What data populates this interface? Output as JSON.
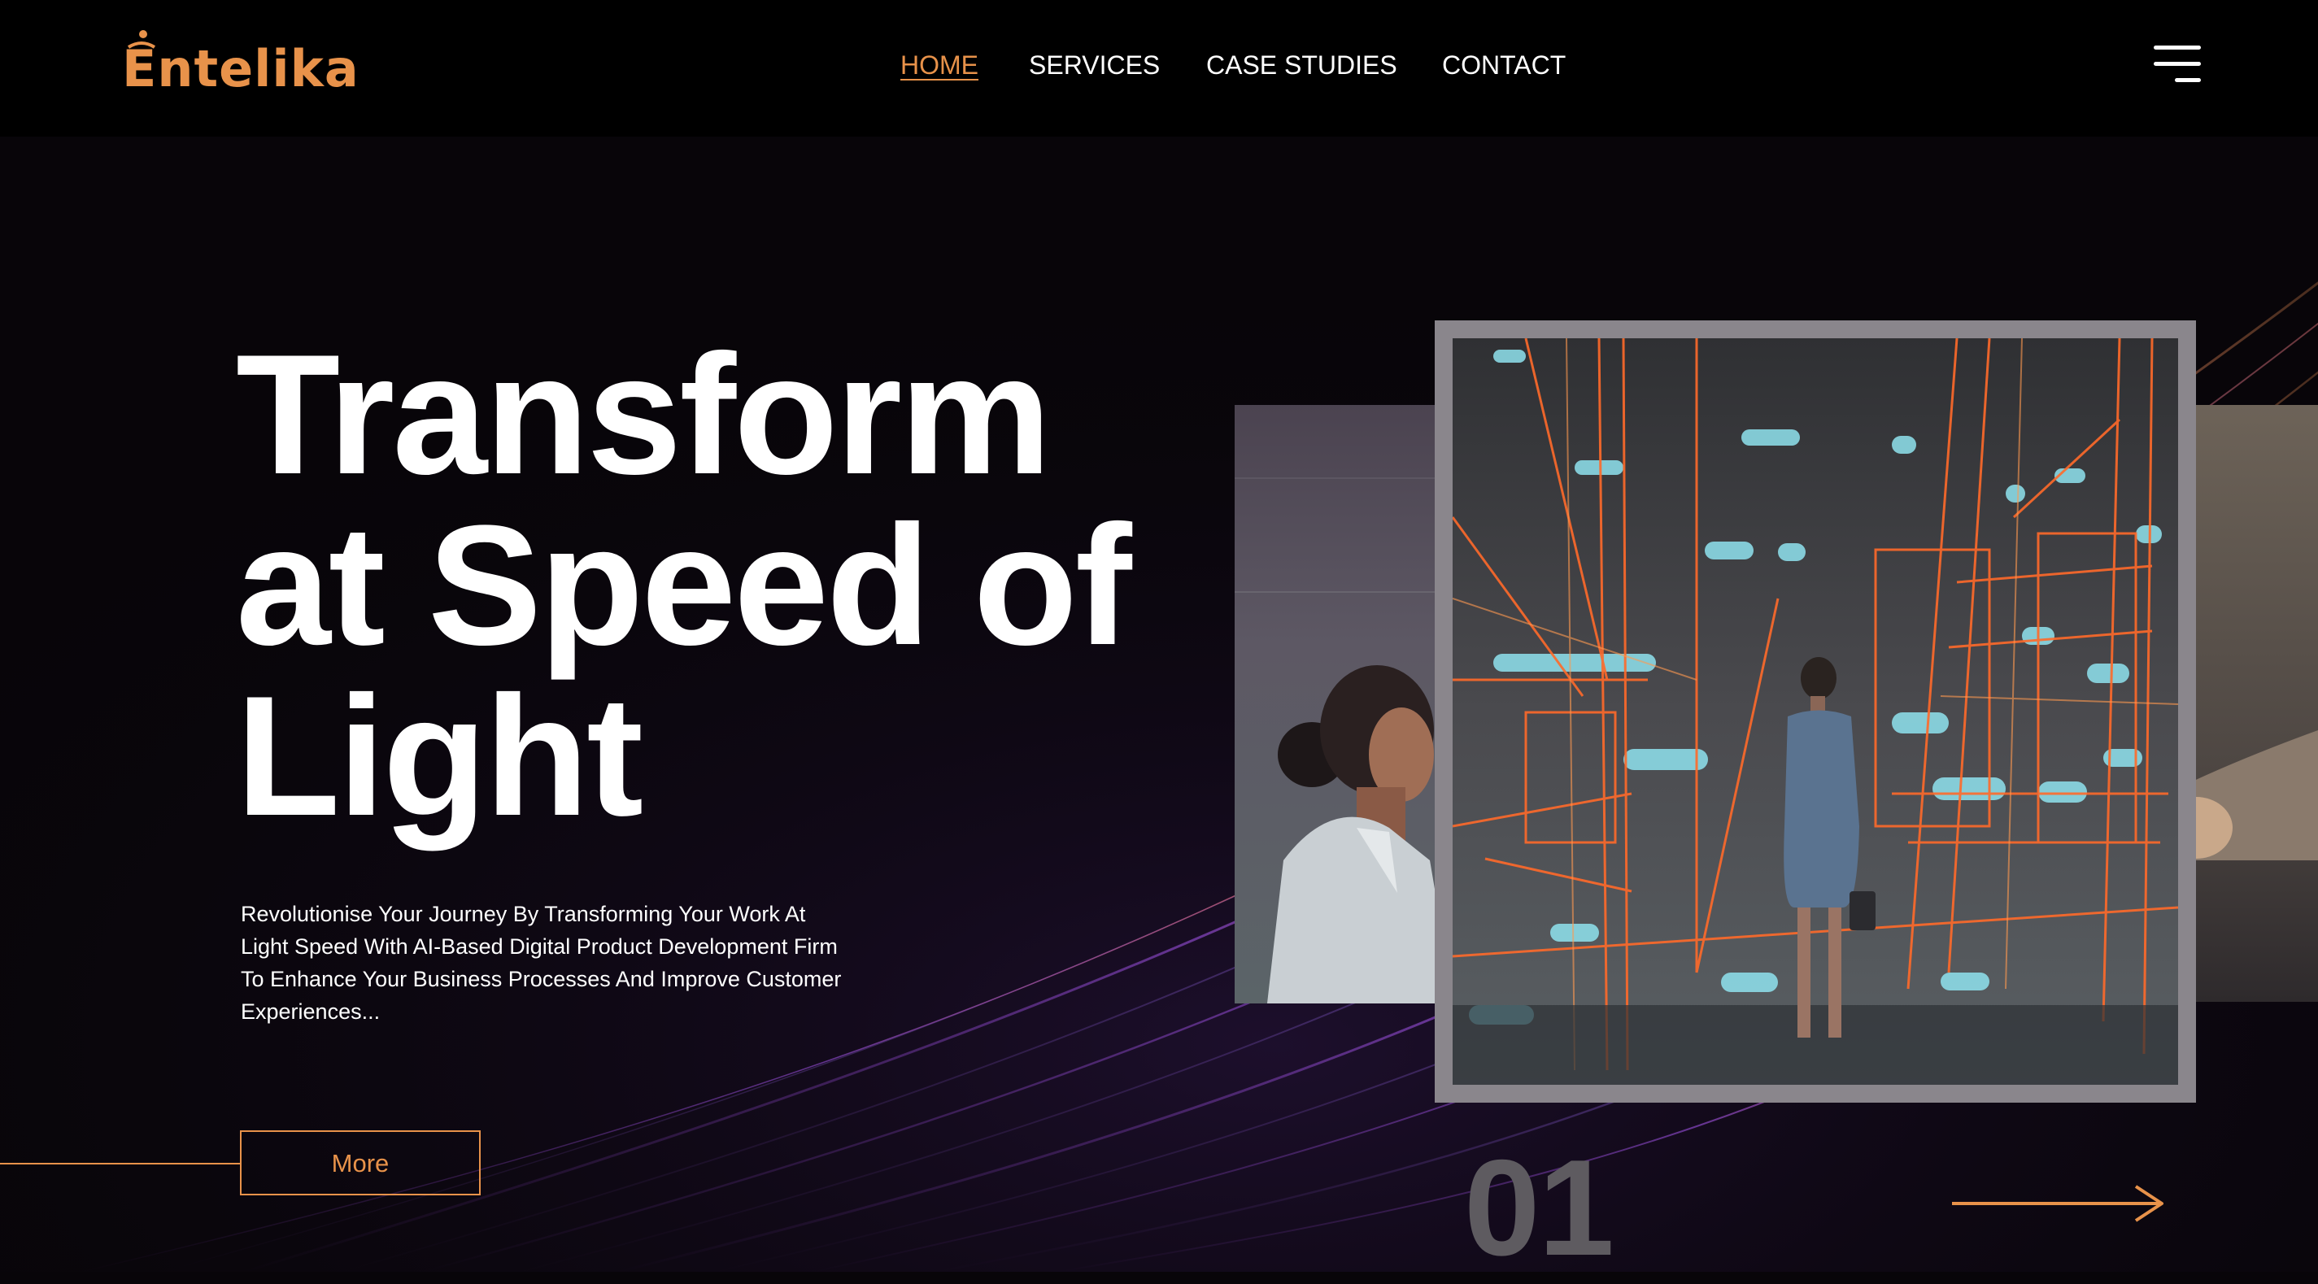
{
  "brand": {
    "name": "Entelika",
    "accent": "#e8924a"
  },
  "nav": {
    "items": [
      {
        "label": "HOME",
        "active": true
      },
      {
        "label": "SERVICES",
        "active": false
      },
      {
        "label": "CASE STUDIES",
        "active": false
      },
      {
        "label": "CONTACT",
        "active": false
      }
    ],
    "menu_icon": "hamburger-menu-icon"
  },
  "hero": {
    "title_lines": [
      "Transform",
      "at Speed of",
      "Light"
    ],
    "subtitle": "Revolutionise Your Journey By Transforming Your Work At Light Speed With AI-Based Digital Product Development Firm To Enhance Your Business Processes And Improve Customer Experiences...",
    "more_label": "More"
  },
  "slider": {
    "slide_number": "01",
    "next_icon": "arrow-right-icon"
  }
}
